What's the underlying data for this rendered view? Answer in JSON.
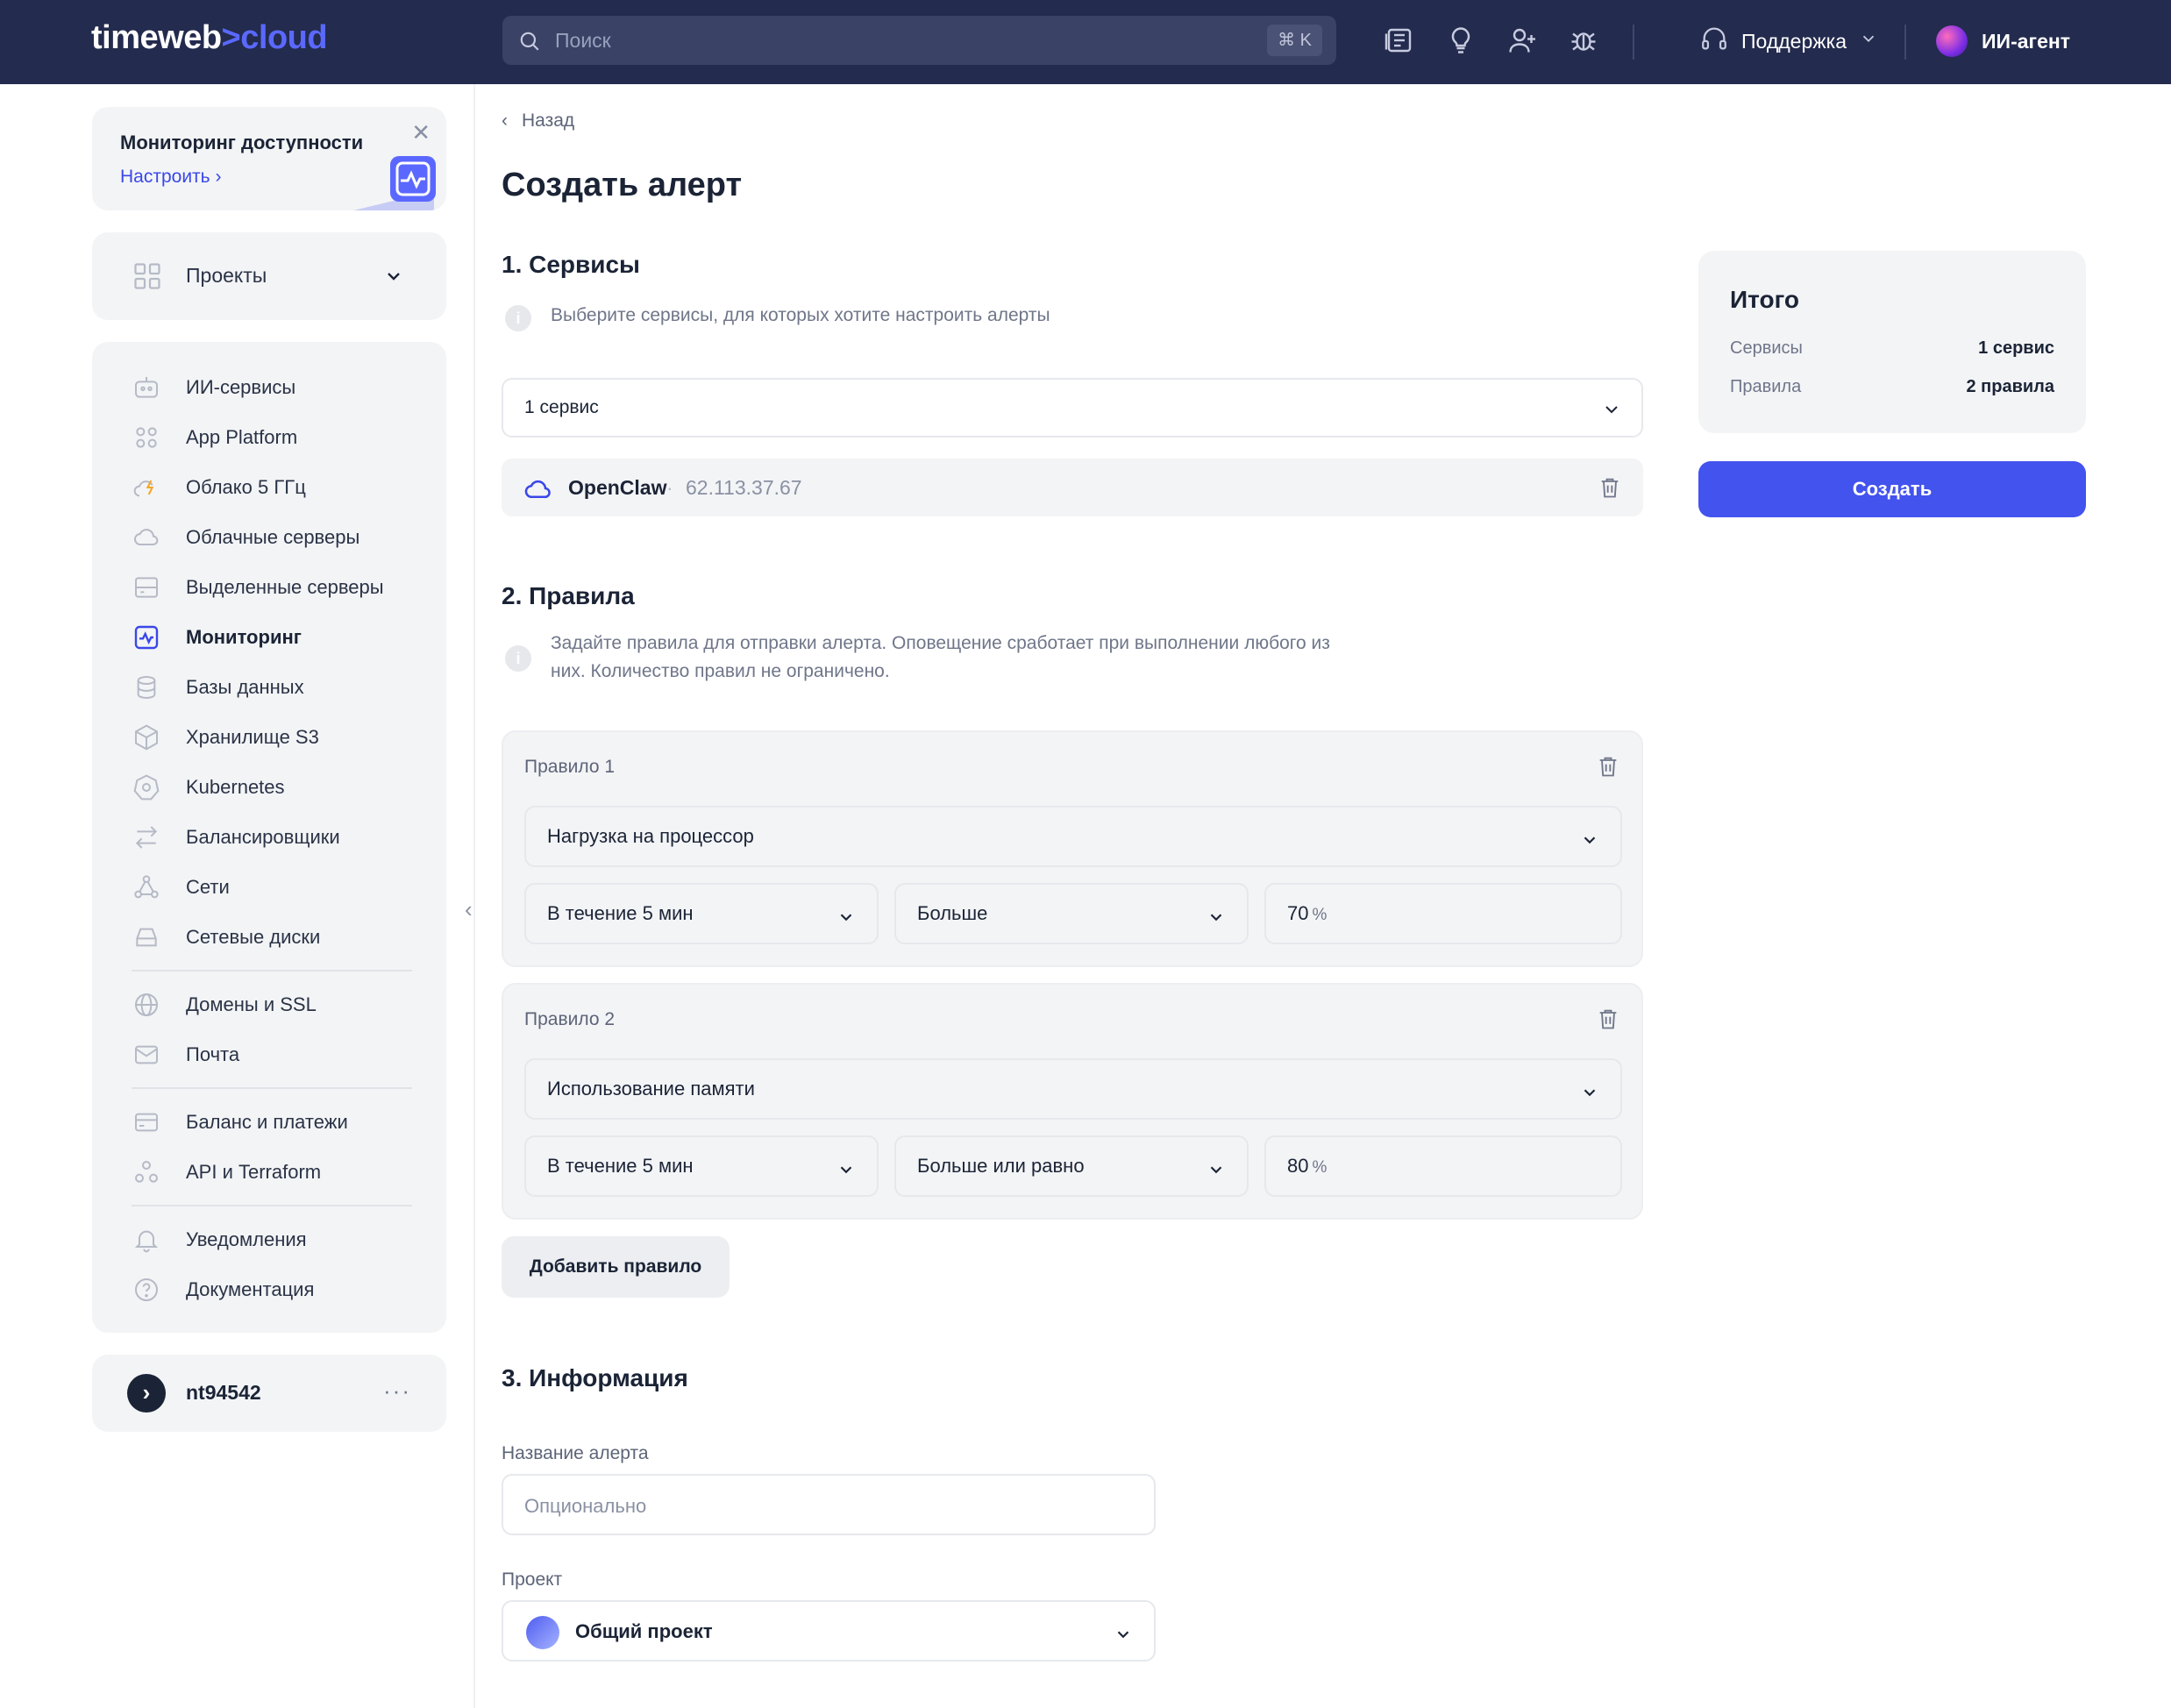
{
  "header": {
    "logo_main": "timeweb",
    "logo_sep": ">",
    "logo_accent": "cloud",
    "search_placeholder": "Поиск",
    "search_shortcut": "⌘ K",
    "support_label": "Поддержка",
    "agent_label": "ИИ-агент"
  },
  "promo": {
    "title": "Мониторинг доступности",
    "link": "Настроить"
  },
  "sidebar": {
    "projects_label": "Проекты",
    "items": [
      {
        "label": "ИИ-сервисы",
        "icon": "robot-icon"
      },
      {
        "label": "App Platform",
        "icon": "grid-icon"
      },
      {
        "label": "Облако 5 ГГц",
        "icon": "cloud-bolt-icon"
      },
      {
        "label": "Облачные серверы",
        "icon": "cloud-icon"
      },
      {
        "label": "Выделенные серверы",
        "icon": "server-icon"
      },
      {
        "label": "Мониторинг",
        "icon": "monitoring-icon",
        "active": true
      },
      {
        "label": "Базы данных",
        "icon": "database-icon"
      },
      {
        "label": "Хранилище S3",
        "icon": "cube-icon"
      },
      {
        "label": "Kubernetes",
        "icon": "kubernetes-icon"
      },
      {
        "label": "Балансировщики",
        "icon": "arrows-icon"
      },
      {
        "label": "Сети",
        "icon": "network-icon"
      },
      {
        "label": "Сетевые диски",
        "icon": "disk-icon"
      },
      {
        "label": "Домены и SSL",
        "icon": "globe-icon"
      },
      {
        "label": "Почта",
        "icon": "mail-icon"
      },
      {
        "label": "Баланс и платежи",
        "icon": "card-icon"
      },
      {
        "label": "API и Terraform",
        "icon": "api-icon"
      },
      {
        "label": "Уведомления",
        "icon": "bell-icon"
      },
      {
        "label": "Документация",
        "icon": "help-icon"
      }
    ],
    "user_name": "nt94542",
    "user_more": "···"
  },
  "main": {
    "back_label": "Назад",
    "title": "Создать алерт",
    "services": {
      "heading": "1. Сервисы",
      "hint": "Выберите сервисы, для которых хотите настроить алерты",
      "select_value": "1 сервис",
      "service_name": "OpenClaw",
      "service_dot": "·",
      "service_ip": "62.113.37.67"
    },
    "rules": {
      "heading": "2. Правила",
      "hint_line1": "Задайте правила для отправки алерта. Оповещение сработает при выполнении любого из",
      "hint_line2": "них. Количество правил не ограничено.",
      "items": [
        {
          "title": "Правило 1",
          "metric": "Нагрузка на процессор",
          "period": "В течение 5 мин",
          "operator": "Больше",
          "value": "70",
          "unit": "%"
        },
        {
          "title": "Правило 2",
          "metric": "Использование памяти",
          "period": "В течение 5 мин",
          "operator": "Больше или равно",
          "value": "80",
          "unit": "%"
        }
      ],
      "add_label": "Добавить правило"
    },
    "info": {
      "heading": "3. Информация",
      "name_label": "Название алерта",
      "name_placeholder": "Опционально",
      "project_label": "Проект",
      "project_value": "Общий проект"
    }
  },
  "summary": {
    "title": "Итого",
    "services_key": "Сервисы",
    "services_val": "1 сервис",
    "rules_key": "Правила",
    "rules_val": "2 правила",
    "create_label": "Создать"
  },
  "colors": {
    "header_bg": "#232b4e",
    "accent": "#4353ee",
    "logo_accent": "#5b68ff"
  }
}
